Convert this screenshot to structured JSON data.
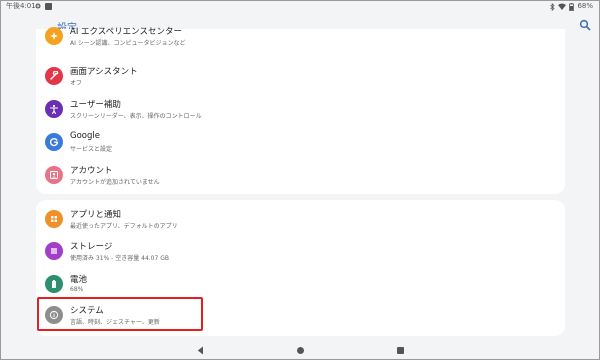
{
  "statusbar": {
    "time": "午後4:01",
    "battery": "68%"
  },
  "header": {
    "title": "設定"
  },
  "groups": [
    {
      "items": [
        {
          "label": "AI エクスペリエンスセンター",
          "sub": "AI シーン認識、コンピュータビジョンなど",
          "icon": "ai-icon",
          "color": "#f4a21f"
        },
        {
          "label": "画面アシスタント",
          "sub": "オフ",
          "icon": "wrench-icon",
          "color": "#e2364a"
        },
        {
          "label": "ユーザー補助",
          "sub": "スクリーンリーダー、表示、操作のコントロール",
          "icon": "accessibility-icon",
          "color": "#6a2fb2"
        },
        {
          "label": "Google",
          "sub": "サービスと設定",
          "icon": "google-icon",
          "color": "#3a7ad8"
        },
        {
          "label": "アカウント",
          "sub": "アカウントが追加されていません",
          "icon": "account-icon",
          "color": "#e8748a"
        }
      ]
    },
    {
      "items": [
        {
          "label": "アプリと通知",
          "sub": "最近使ったアプリ、デフォルトのアプリ",
          "icon": "apps-icon",
          "color": "#f0902a"
        },
        {
          "label": "ストレージ",
          "sub": "使用済み 31% - 空き容量 44.07 GB",
          "icon": "storage-icon",
          "color": "#a23fc8"
        },
        {
          "label": "電池",
          "sub": "68%",
          "icon": "battery-icon",
          "color": "#2d8f6e"
        },
        {
          "label": "システム",
          "sub": "言語、時刻、ジェスチャー、更新",
          "icon": "info-icon",
          "color": "#8e8e8e"
        }
      ]
    }
  ]
}
